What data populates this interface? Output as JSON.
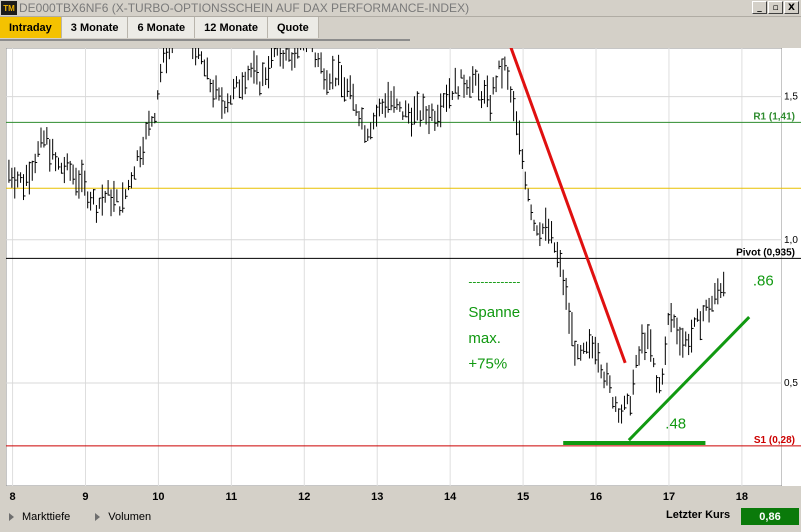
{
  "window": {
    "icon_text": "TM",
    "title": "DE000TBX6NF6 (X-TURBO-OPTIONSSCHEIN AUF DAX PERFORMANCE-INDEX)",
    "buttons": [
      "_",
      "▫",
      "X"
    ]
  },
  "tabs": [
    {
      "label": "Intraday",
      "active": true
    },
    {
      "label": "3 Monate",
      "active": false
    },
    {
      "label": "6 Monate",
      "active": false
    },
    {
      "label": "12 Monate",
      "active": false
    },
    {
      "label": "Quote",
      "active": false
    }
  ],
  "chart_data": {
    "type": "bar",
    "x_ticks": [
      "8",
      "9",
      "10",
      "11",
      "12",
      "13",
      "14",
      "15",
      "16",
      "17",
      "18"
    ],
    "y_ticks": [
      {
        "value": 1.5,
        "label": "1,5"
      },
      {
        "value": 1.0,
        "label": "1,0"
      },
      {
        "value": 0.5,
        "label": "0,5"
      }
    ],
    "ylim": [
      0.14,
      1.67
    ],
    "xlim": [
      7.91,
      18.55
    ],
    "grid": true,
    "reference_lines": [
      {
        "name": "R1",
        "value": 1.41,
        "label": "R1 (1,41)",
        "color": "#2e8b2e"
      },
      {
        "name": "yellow",
        "value": 1.18,
        "label": "",
        "color": "#e8c000"
      },
      {
        "name": "Pivot",
        "value": 0.935,
        "label": "Pivot (0,935)",
        "color": "#000000"
      },
      {
        "name": "S1",
        "value": 0.28,
        "label": "S1 (0,28)",
        "color": "#cc0000"
      }
    ],
    "series_anchors": [
      [
        7.95,
        1.24
      ],
      [
        8.15,
        1.2
      ],
      [
        8.3,
        1.28
      ],
      [
        8.45,
        1.36
      ],
      [
        8.6,
        1.26
      ],
      [
        8.8,
        1.24
      ],
      [
        9.0,
        1.18
      ],
      [
        9.15,
        1.12
      ],
      [
        9.3,
        1.16
      ],
      [
        9.5,
        1.12
      ],
      [
        9.7,
        1.28
      ],
      [
        9.85,
        1.38
      ],
      [
        9.95,
        1.45
      ],
      [
        10.05,
        1.62
      ],
      [
        10.2,
        1.72
      ],
      [
        10.3,
        1.76
      ],
      [
        10.45,
        1.7
      ],
      [
        10.6,
        1.62
      ],
      [
        10.7,
        1.55
      ],
      [
        10.85,
        1.48
      ],
      [
        11.0,
        1.5
      ],
      [
        11.1,
        1.54
      ],
      [
        11.25,
        1.6
      ],
      [
        11.4,
        1.55
      ],
      [
        11.5,
        1.6
      ],
      [
        11.6,
        1.66
      ],
      [
        11.75,
        1.65
      ],
      [
        11.9,
        1.64
      ],
      [
        12.0,
        1.7
      ],
      [
        12.05,
        1.74
      ],
      [
        12.15,
        1.64
      ],
      [
        12.3,
        1.58
      ],
      [
        12.45,
        1.57
      ],
      [
        12.6,
        1.52
      ],
      [
        12.75,
        1.45
      ],
      [
        12.85,
        1.38
      ],
      [
        13.0,
        1.44
      ],
      [
        13.15,
        1.5
      ],
      [
        13.3,
        1.45
      ],
      [
        13.45,
        1.44
      ],
      [
        13.6,
        1.44
      ],
      [
        13.8,
        1.44
      ],
      [
        13.9,
        1.5
      ],
      [
        14.0,
        1.52
      ],
      [
        14.15,
        1.55
      ],
      [
        14.3,
        1.56
      ],
      [
        14.4,
        1.52
      ],
      [
        14.55,
        1.48
      ],
      [
        14.65,
        1.58
      ],
      [
        14.75,
        1.6
      ],
      [
        14.85,
        1.48
      ],
      [
        14.95,
        1.34
      ],
      [
        15.05,
        1.2
      ],
      [
        15.15,
        1.06
      ],
      [
        15.25,
        1.04
      ],
      [
        15.35,
        1.03
      ],
      [
        15.45,
        0.96
      ],
      [
        15.55,
        0.86
      ],
      [
        15.65,
        0.7
      ],
      [
        15.75,
        0.58
      ],
      [
        15.85,
        0.6
      ],
      [
        16.0,
        0.64
      ],
      [
        16.1,
        0.54
      ],
      [
        16.25,
        0.44
      ],
      [
        16.35,
        0.4
      ],
      [
        16.45,
        0.42
      ],
      [
        16.55,
        0.55
      ],
      [
        16.65,
        0.66
      ],
      [
        16.75,
        0.62
      ],
      [
        16.85,
        0.46
      ],
      [
        16.95,
        0.6
      ],
      [
        17.0,
        0.74
      ],
      [
        17.1,
        0.7
      ],
      [
        17.2,
        0.64
      ],
      [
        17.3,
        0.66
      ],
      [
        17.45,
        0.74
      ],
      [
        17.6,
        0.78
      ],
      [
        17.75,
        0.86
      ]
    ],
    "annotations": {
      "spanne_lines": [
        "-------------",
        "Spanne",
        "max.",
        "+75%"
      ],
      "low_label": ".48",
      "high_label": ".86",
      "red_trend": [
        [
          14.75,
          1.73
        ],
        [
          16.4,
          0.57
        ]
      ],
      "green_trend": [
        [
          16.45,
          0.3
        ],
        [
          18.1,
          0.73
        ]
      ],
      "green_base": [
        [
          15.55,
          0.29
        ],
        [
          17.5,
          0.29
        ]
      ]
    }
  },
  "bottom_bar": {
    "items": [
      "Markttiefe",
      "Volumen"
    ],
    "last_label": "Letzter Kurs",
    "last_value": "0,86"
  }
}
